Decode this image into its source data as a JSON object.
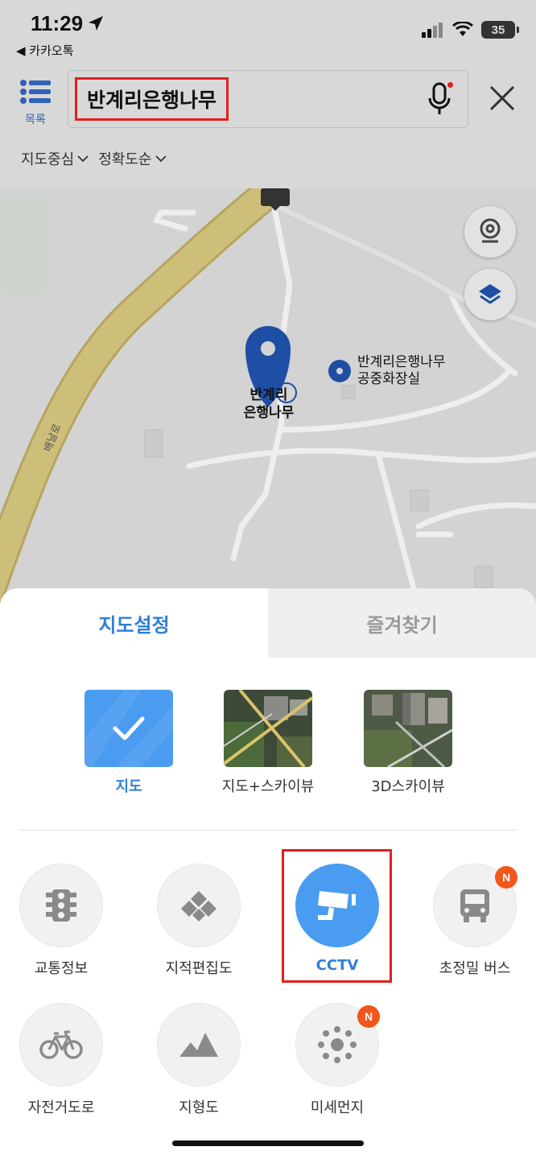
{
  "status_bar": {
    "time": "11:29",
    "back_app": "◀ 카카오톡",
    "battery": "35"
  },
  "header": {
    "list_label": "목록",
    "search_value": "반계리은행나무",
    "filter_center": "지도중심",
    "filter_sort": "정확도순"
  },
  "map": {
    "pin_label_line1": "반계리",
    "pin_label_line2": "은행나무",
    "toilet_label_line1": "반계리은행나무",
    "toilet_label_line2": "공중화장실",
    "road_label": "배날로"
  },
  "sheet": {
    "tabs": [
      {
        "label": "지도설정",
        "active": true
      },
      {
        "label": "즐겨찾기",
        "active": false
      }
    ],
    "map_types": [
      {
        "label": "지도",
        "selected": true
      },
      {
        "label": "지도+스카이뷰",
        "selected": false
      },
      {
        "label": "3D스카이뷰",
        "selected": false
      }
    ],
    "layers": [
      {
        "label": "교통정보",
        "icon": "traffic-light-icon"
      },
      {
        "label": "지적편집도",
        "icon": "cadastral-icon"
      },
      {
        "label": "CCTV",
        "icon": "cctv-icon",
        "active": true
      },
      {
        "label": "초정밀 버스",
        "icon": "bus-icon",
        "badge": "N"
      },
      {
        "label": "자전거도로",
        "icon": "bicycle-icon"
      },
      {
        "label": "지형도",
        "icon": "mountain-icon"
      },
      {
        "label": "미세먼지",
        "icon": "dust-icon",
        "badge": "N"
      }
    ]
  },
  "colors": {
    "accent": "#2f7fd8",
    "active_circle": "#4a9cf0",
    "badge": "#f2561b",
    "highlight": "#e0201e"
  }
}
